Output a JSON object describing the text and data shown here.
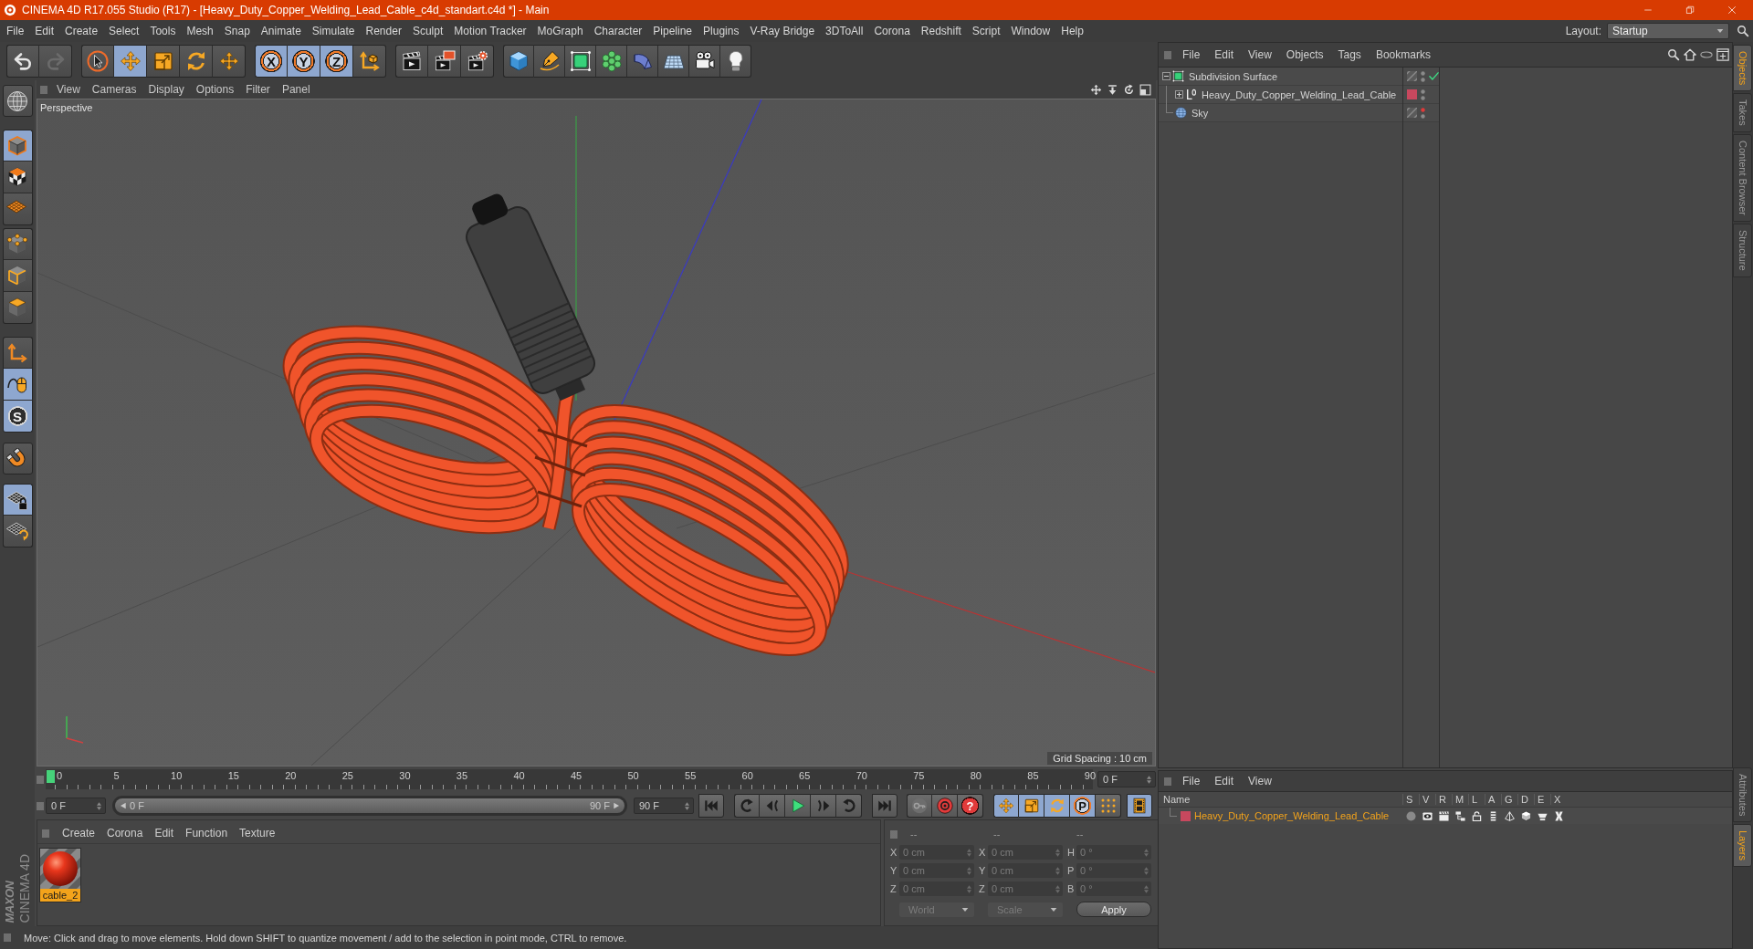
{
  "window": {
    "title": "CINEMA 4D R17.055 Studio (R17) - [Heavy_Duty_Copper_Welding_Lead_Cable_c4d_standart.c4d *] - Main"
  },
  "menu_bar": [
    "File",
    "Edit",
    "Create",
    "Select",
    "Tools",
    "Mesh",
    "Snap",
    "Animate",
    "Simulate",
    "Render",
    "Sculpt",
    "Motion Tracker",
    "MoGraph",
    "Character",
    "Pipeline",
    "Plugins",
    "V-Ray Bridge",
    "3DToAll",
    "Corona",
    "Redshift",
    "Script",
    "Window",
    "Help"
  ],
  "layout": {
    "label": "Layout:",
    "value": "Startup"
  },
  "toolbar": {
    "history": [
      {
        "disabled": false
      },
      {
        "disabled": true
      }
    ],
    "tools": [
      {
        "selected": false
      },
      {
        "selected": true
      },
      {
        "selected": false
      },
      {
        "selected": false
      },
      {
        "selected": false
      }
    ],
    "axis_locks": [
      {
        "label": "X",
        "selected": true
      },
      {
        "label": "Y",
        "selected": true
      },
      {
        "label": "Z",
        "selected": true
      }
    ],
    "coordinate_system": {
      "selected": false
    }
  },
  "mode_toolbar": {
    "modes": [
      {
        "selected": true
      },
      {
        "selected": false
      },
      {
        "selected": false
      }
    ],
    "components": [
      {
        "selected": false
      },
      {
        "selected": false
      },
      {
        "selected": false
      }
    ],
    "options": [
      {
        "selected": false
      },
      {
        "selected": true
      },
      {
        "label": "S",
        "selected": true
      }
    ],
    "workplane": [
      {
        "selected": true
      },
      {
        "selected": false
      }
    ]
  },
  "viewport": {
    "menu": [
      "View",
      "Cameras",
      "Display",
      "Options",
      "Filter",
      "Panel"
    ],
    "camera": "Perspective",
    "grid_spacing": "Grid Spacing : 10 cm"
  },
  "timeline": {
    "ticks": [
      "0",
      "5",
      "10",
      "15",
      "20",
      "25",
      "30",
      "35",
      "40",
      "45",
      "50",
      "55",
      "60",
      "65",
      "70",
      "75",
      "80",
      "85",
      "90"
    ],
    "level": 0,
    "current_frame": "0 F",
    "start_frame": "0 F",
    "range": {
      "start": "0 F",
      "end": "90 F",
      "level": 1
    },
    "end_frame": "90 F",
    "autokey_label": "?",
    "tracks": [
      {
        "selected": true
      },
      {
        "selected": true
      },
      {
        "selected": true
      },
      {
        "label": "P",
        "selected": true
      },
      {
        "selected": false
      }
    ],
    "timeline_button": {
      "selected": true
    }
  },
  "material_manager": {
    "menu": [
      "Create",
      "Corona",
      "Edit",
      "Function",
      "Texture"
    ],
    "materials": [
      {
        "name": "cable_2",
        "selected": true
      }
    ]
  },
  "coordinates": {
    "disabled": true,
    "headers": [
      "--",
      "--",
      "--"
    ],
    "rows": [
      [
        {
          "label": "X",
          "value": "0 cm"
        },
        {
          "label": "X",
          "value": "0 cm"
        },
        {
          "label": "H",
          "value": "0 °"
        }
      ],
      [
        {
          "label": "Y",
          "value": "0 cm"
        },
        {
          "label": "Y",
          "value": "0 cm"
        },
        {
          "label": "P",
          "value": "0 °"
        }
      ],
      [
        {
          "label": "Z",
          "value": "0 cm"
        },
        {
          "label": "Z",
          "value": "0 cm"
        },
        {
          "label": "B",
          "value": "0 °"
        }
      ]
    ],
    "dropdowns": [
      "World",
      "Scale"
    ],
    "apply": "Apply"
  },
  "logo": {
    "brand": "MAXON",
    "product": "CINEMA 4D"
  },
  "status_bar": "Move: Click and drag to move elements. Hold down SHIFT to quantize movement / add to the selection in point mode, CTRL to remove.",
  "object_manager": {
    "menu": [
      "File",
      "Edit",
      "View",
      "Objects",
      "Tags",
      "Bookmarks"
    ],
    "objects": [
      {
        "name": "Subdivision Surface",
        "kind": "subdivision",
        "expanded": true,
        "enabled": true,
        "visible_in_editor": true,
        "children": [
          {
            "name": "Heavy_Duty_Copper_Welding_Lead_Cable",
            "kind": "null",
            "expanded": false,
            "color": "#c8485e",
            "visible_in_editor": true
          }
        ]
      },
      {
        "name": "Sky",
        "kind": "sky",
        "visible_in_editor": false
      }
    ]
  },
  "layer_manager": {
    "menu": [
      "File",
      "Edit",
      "View"
    ],
    "columns": [
      "Name",
      "S",
      "V",
      "R",
      "M",
      "L",
      "A",
      "G",
      "D",
      "E",
      "X"
    ],
    "layers": [
      {
        "name": "Heavy_Duty_Copper_Welding_Lead_Cable",
        "color": "#c8485e",
        "selected": true
      }
    ]
  },
  "side_tabs": {
    "top": [
      {
        "label": "Objects",
        "selected": true
      },
      {
        "label": "Takes",
        "selected": false
      },
      {
        "label": "Content Browser",
        "selected": false
      },
      {
        "label": "Structure",
        "selected": false
      }
    ],
    "bottom": [
      {
        "label": "Attributes",
        "selected": false
      },
      {
        "label": "Layers",
        "selected": true
      }
    ]
  }
}
